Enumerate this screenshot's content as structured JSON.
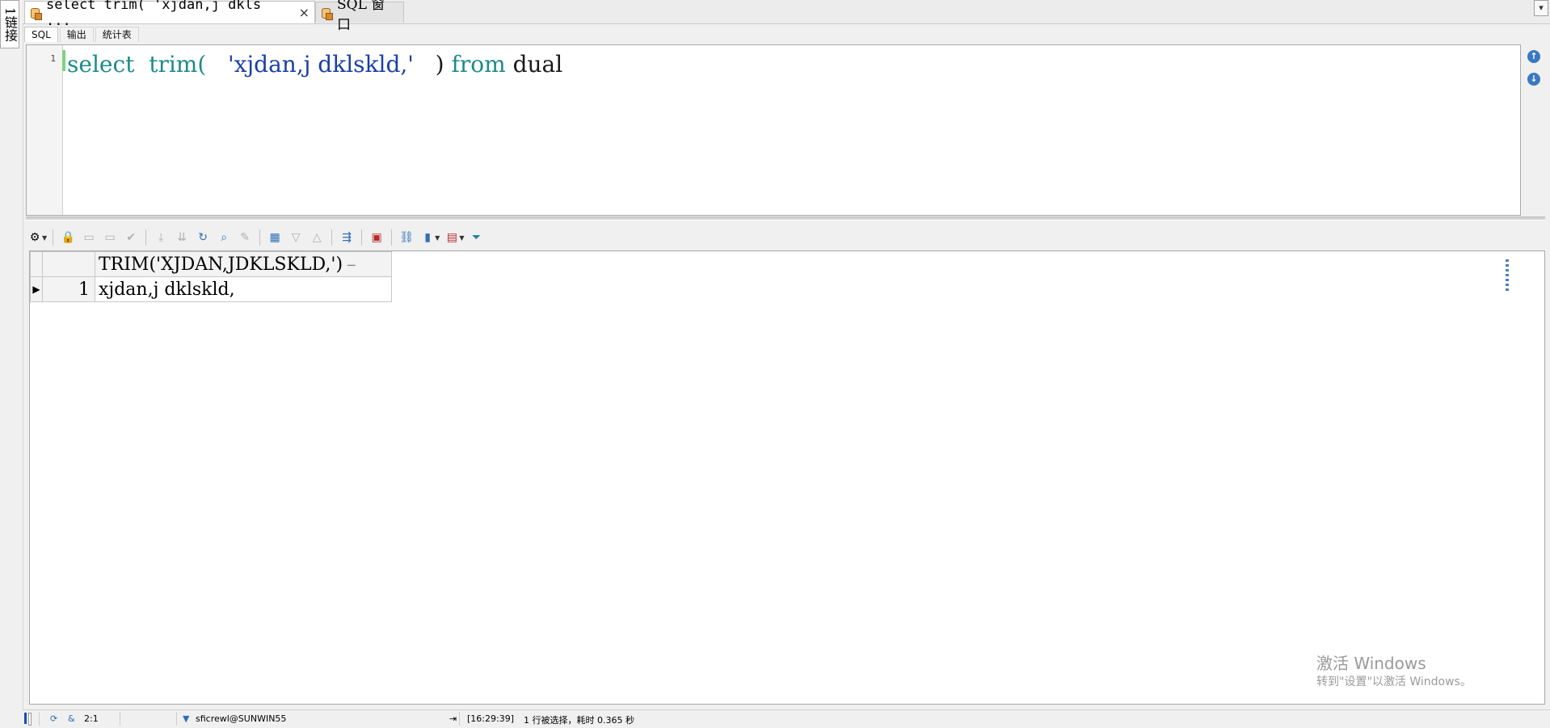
{
  "left_panel": {
    "connection_tab": "1链接"
  },
  "doc_tabs": [
    {
      "label": "select trim( 'xjdan,j dkls ...",
      "close": "×"
    },
    {
      "label": "SQL 窗口"
    }
  ],
  "sub_tabs": [
    "SQL",
    "输出",
    "统计表"
  ],
  "editor": {
    "line_number": "1",
    "code": {
      "kw1": "select",
      "kw2": "trim(",
      "str": "'xjdan,j dklskld,'",
      "paren": ")",
      "kw3": "from",
      "table": "dual"
    }
  },
  "grid": {
    "columns": [
      "TRIM('XJDAN,JDKLSKLD,')"
    ],
    "rows": [
      {
        "num": "1",
        "cells": [
          "xjdan,j dklskld,"
        ]
      }
    ]
  },
  "watermark": {
    "line1": "激活 Windows",
    "line2": "转到\"设置\"以激活 Windows。"
  },
  "status": {
    "position": "2:1",
    "connection": "sficrewl@SUNWIN55",
    "time": "[16:29:39]",
    "message": "1 行被选择，耗时 0.365 秒"
  },
  "colors": {
    "keyword": "#1d8a8a",
    "string": "#1a3fa8",
    "status_indicator": "#1b49b8"
  }
}
